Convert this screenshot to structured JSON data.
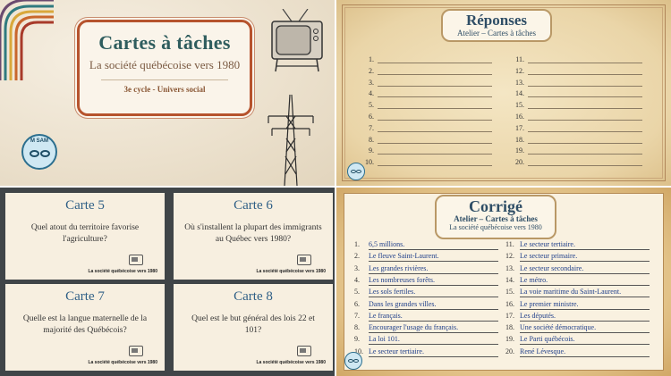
{
  "title_slide": {
    "title": "Cartes à tâches",
    "subtitle": "La société québécoise vers 1980",
    "meta": "3e cycle - Univers social",
    "logo_text": "M SAM"
  },
  "reponses": {
    "title": "Réponses",
    "subtitle": "Atelier – Cartes à tâches",
    "numbers_left": [
      "1.",
      "2.",
      "3.",
      "4.",
      "5.",
      "6.",
      "7.",
      "8.",
      "9.",
      "10."
    ],
    "numbers_right": [
      "11.",
      "12.",
      "13.",
      "14.",
      "15.",
      "16.",
      "17.",
      "18.",
      "19.",
      "20."
    ]
  },
  "cards": [
    {
      "title": "Carte 5",
      "question": "Quel atout du territoire favorise l'agriculture?",
      "footer": "La société québécoise vers 1980"
    },
    {
      "title": "Carte 6",
      "question": "Où s'installent la plupart des immigrants au Québec vers 1980?",
      "footer": "La société québécoise vers 1980"
    },
    {
      "title": "Carte 7",
      "question": "Quelle est la langue maternelle de la majorité des Québécois?",
      "footer": "La société québécoise vers 1980"
    },
    {
      "title": "Carte 8",
      "question": "Quel est le but général des lois 22 et 101?",
      "footer": "La société québécoise vers 1980"
    }
  ],
  "corrige": {
    "title": "Corrigé",
    "subtitle": "Atelier – Cartes à tâches",
    "subtitle2": "La société québécoise vers 1980",
    "left": [
      {
        "n": "1.",
        "a": "6,5 millions."
      },
      {
        "n": "2.",
        "a": "Le fleuve Saint-Laurent."
      },
      {
        "n": "3.",
        "a": "Les grandes rivières."
      },
      {
        "n": "4.",
        "a": "Les nombreuses forêts."
      },
      {
        "n": "5.",
        "a": "Les sols fertiles."
      },
      {
        "n": "6.",
        "a": "Dans les grandes villes."
      },
      {
        "n": "7.",
        "a": "Le français."
      },
      {
        "n": "8.",
        "a": "Encourager l'usage du français."
      },
      {
        "n": "9.",
        "a": "La loi 101."
      },
      {
        "n": "10.",
        "a": "Le secteur tertiaire."
      }
    ],
    "right": [
      {
        "n": "11.",
        "a": "Le secteur tertiaire."
      },
      {
        "n": "12.",
        "a": "Le secteur primaire."
      },
      {
        "n": "13.",
        "a": "Le secteur secondaire."
      },
      {
        "n": "14.",
        "a": "Le métro."
      },
      {
        "n": "15.",
        "a": "La voie maritime du Saint-Laurent."
      },
      {
        "n": "16.",
        "a": "Le premier ministre."
      },
      {
        "n": "17.",
        "a": "Les députés."
      },
      {
        "n": "18.",
        "a": "Une société démocratique."
      },
      {
        "n": "19.",
        "a": "Le Parti québécois."
      },
      {
        "n": "20.",
        "a": "René Lévesque."
      }
    ]
  },
  "colors": {
    "teal": "#2f5d5e",
    "rust": "#b6532d",
    "blue_title": "#2f5f86",
    "answer_blue": "#1f3f8a"
  }
}
